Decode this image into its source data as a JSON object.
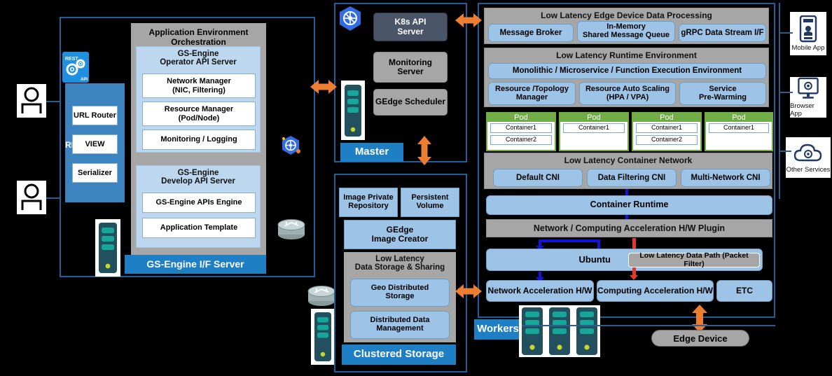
{
  "actors": {
    "user1": "user-icon",
    "user2": "user-icon"
  },
  "left_panel": {
    "rest_api_icon": "rest-api-icon",
    "rest_server": {
      "title": "REST Server",
      "items": [
        "URL Router",
        "VIEW",
        "Serializer"
      ]
    },
    "orchestration": {
      "title": "Application Environment Orchestration",
      "operator": {
        "title": "GS-Engine\nOperator API Server",
        "title_line1": "GS-Engine",
        "title_line2": "Operator API Server",
        "items": [
          {
            "line1": "Network Manager",
            "line2": "(NIC, Filtering)"
          },
          {
            "line1": "Resource Manager",
            "line2": "(Pod/Node)"
          },
          {
            "line1": "Monitoring / Logging",
            "line2": ""
          }
        ]
      },
      "develop": {
        "title_line1": "GS-Engine",
        "title_line2": "Develop API Server",
        "items": [
          {
            "line1": "GS-Engine APIs Engine",
            "line2": ""
          },
          {
            "line1": "Application Template",
            "line2": ""
          }
        ]
      }
    },
    "footer_bar": "GS-Engine I/F Server",
    "k8s_icon": "kubernetes-icon",
    "router_icon": "router-icon",
    "server_icon": "server-icon"
  },
  "master_panel": {
    "k8s_icon": "kubernetes-icon",
    "boxes": [
      {
        "line1": "K8s API",
        "line2": "Server",
        "style": "dark"
      },
      {
        "line1": "Monitoring",
        "line2": "Server",
        "style": "gray"
      },
      {
        "line1": "GEdge Scheduler",
        "line2": "",
        "style": "gray"
      }
    ],
    "server_icon": "server-icon",
    "label": "Master"
  },
  "storage_panel": {
    "top_boxes": [
      {
        "line1": "Image Private",
        "line2": "Repository"
      },
      {
        "line1": "Persistent",
        "line2": "Volume"
      }
    ],
    "image_creator": {
      "line1": "GEdge",
      "line2": "Image Creator"
    },
    "low_latency": {
      "title_line1": "Low Latency",
      "title_line2": "Data Storage & Sharing",
      "items": [
        {
          "line1": "Geo Distributed",
          "line2": "Storage"
        },
        {
          "line1": "Distributed Data",
          "line2": "Management"
        }
      ]
    },
    "label": "Clustered Storage",
    "router_icon": "router-icon",
    "server_icon": "server-icon"
  },
  "edge_panel": {
    "data_processing": {
      "title": "Low Latency Edge Device Data Processing",
      "items": [
        {
          "line1": "Message Broker",
          "line2": ""
        },
        {
          "line1": "In-Memory",
          "line2": "Shared Message Queue"
        },
        {
          "line1": "gRPC Data Stream I/F",
          "line2": ""
        }
      ]
    },
    "runtime": {
      "title": "Low Latency Runtime Environment",
      "wide_item": "Monolithic / Microservice / Function Execution Environment",
      "items": [
        {
          "line1": "Resource /Topology",
          "line2": "Manager"
        },
        {
          "line1": "Resource Auto Scaling",
          "line2": "(HPA / VPA)"
        },
        {
          "line1": "Service",
          "line2": "Pre-Warming"
        }
      ]
    },
    "pods": [
      {
        "title": "Pod",
        "containers": [
          "Container1",
          "Container2"
        ]
      },
      {
        "title": "Pod",
        "containers": [
          "Container1"
        ]
      },
      {
        "title": "Pod",
        "containers": [
          "Container1",
          "Container2"
        ]
      },
      {
        "title": "Pod",
        "containers": [
          "Container1"
        ]
      }
    ],
    "container_network": {
      "title": "Low Latency Container Network",
      "items": [
        "Default CNI",
        "Data Filtering CNI",
        "Multi-Network CNI"
      ]
    },
    "container_runtime": "Container Runtime",
    "hw_plugin": "Network / Computing Acceleration H/W Plugin",
    "os": {
      "name": "Ubuntu",
      "data_path": "Low Latency Data Path (Packet Filter)"
    },
    "hw": [
      "Network Acceleration H/W",
      "Computing Acceleration H/W",
      "ETC"
    ],
    "workers_label": "Workers",
    "edge_device_label": "Edge Device",
    "server_icon": "server-icon"
  },
  "clients": [
    {
      "label": "Mobile App",
      "icon": "mobile-phone-icon"
    },
    {
      "label": "Browser App",
      "icon": "monitor-gear-icon"
    },
    {
      "label": "Other Services",
      "icon": "cloud-gear-icon"
    }
  ],
  "colors": {
    "accent_orange": "#ED7D31",
    "frame_blue": "#1f5f9e",
    "bar_blue": "#1f7fc4",
    "pod_green": "#70ad47",
    "light_blue": "#9dc3e6",
    "gray": "#a6a6a6",
    "arrow_blue": "#1414d8",
    "arrow_red": "#e8372a"
  }
}
